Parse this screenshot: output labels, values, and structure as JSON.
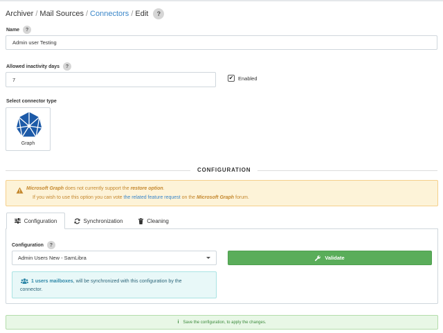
{
  "breadcrumb": {
    "items": [
      {
        "label": "Archiver",
        "link": false
      },
      {
        "label": "Mail Sources",
        "link": false
      },
      {
        "label": "Connectors",
        "link": true
      },
      {
        "label": "Edit",
        "link": false
      }
    ],
    "separator": "/",
    "help": "?"
  },
  "form": {
    "name_label": "Name",
    "name_value": "Admin user Testing",
    "inactivity_label": "Allowed inactivity days",
    "inactivity_value": "7",
    "enabled_label": "Enabled",
    "enabled_checked": true,
    "connector_type_label": "Select connector type",
    "help": "?"
  },
  "connector": {
    "name": "Graph",
    "icon": "microsoft-graph-icon",
    "color": "#1c5aa8"
  },
  "section": {
    "title": "CONFIGURATION"
  },
  "warning": {
    "product": "Microsoft Graph",
    "text1": " does not currently support the ",
    "option": "restore option",
    "text1_end": ".",
    "text2a": "If you wish to use this option you can vote ",
    "link_text": "the related feature request",
    "text2b": " on the ",
    "product2": "Microsoft Graph",
    "text2c": " forum.",
    "icon": "warning-triangle-icon"
  },
  "tabs": [
    {
      "label": "Configuration",
      "icon": "sliders-icon",
      "active": true
    },
    {
      "label": "Synchronization",
      "icon": "sync-icon",
      "active": false
    },
    {
      "label": "Cleaning",
      "icon": "trash-icon",
      "active": false
    }
  ],
  "config": {
    "label": "Configuration",
    "selected": "Admin Users New - SamLibra",
    "validate_label": "Validate",
    "help": "?"
  },
  "info": {
    "strong": "1 users mailboxes",
    "text1": ", will be synchronized with this configuration by the",
    "text2": "connector.",
    "icon": "users-icon"
  },
  "success": {
    "icon": "info-icon",
    "glyph": "i",
    "text": "Save the configuration, to apply the changes."
  },
  "colors": {
    "link": "#3a86c8",
    "validate": "#5aad5a",
    "warning_bg": "#fdf3d8",
    "info_bg": "#e8f8f8",
    "success_bg": "#e8f7e6"
  }
}
